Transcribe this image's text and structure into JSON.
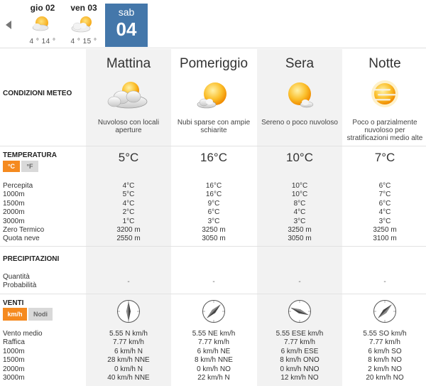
{
  "nav": {
    "prev_icon": "chevron-left-icon",
    "days": [
      {
        "name": "gio 02",
        "temp": "4 ° 14 °",
        "icon": "partly-cloudy-icon"
      },
      {
        "name": "ven 03",
        "temp": "4 ° 15 °",
        "icon": "partly-cloudy-icon"
      }
    ],
    "active_day": {
      "name": "sab",
      "number": "04",
      "color": "#4477aa"
    }
  },
  "periods": [
    {
      "label": "Mattina",
      "icon": "cloudy-sun-icon",
      "description": "Nuvoloso con locali aperture"
    },
    {
      "label": "Pomeriggio",
      "icon": "sun-small-cloud-icon",
      "description": "Nubi sparse con ampie schiarite"
    },
    {
      "label": "Sera",
      "icon": "sun-small-cloud-icon",
      "description": "Sereno o poco nuvoloso"
    },
    {
      "label": "Notte",
      "icon": "hazy-sun-icon",
      "description": "Poco o parzialmente nuvoloso per stratificazioni medio alte"
    }
  ],
  "sections": {
    "conditions": "CONDIZIONI METEO",
    "temperature": "TEMPERATURA",
    "precipitation": "PRECIPITAZIONI",
    "wind": "VENTI"
  },
  "units": {
    "temp_on": "°C",
    "temp_off": "°F",
    "wind_on": "km/h",
    "wind_off": "Nodi",
    "accent": "#f58a1f"
  },
  "temperature": {
    "main": [
      "5°C",
      "16°C",
      "10°C",
      "7°C"
    ],
    "row_labels": [
      "Percepita",
      "1000m",
      "1500m",
      "2000m",
      "3000m",
      "Zero Termico",
      "Quota neve"
    ],
    "columns": [
      [
        "4°C",
        "5°C",
        "4°C",
        "2°C",
        "1°C",
        "3200 m",
        "2550 m"
      ],
      [
        "16°C",
        "16°C",
        "9°C",
        "6°C",
        "3°C",
        "3250 m",
        "3050 m"
      ],
      [
        "10°C",
        "10°C",
        "8°C",
        "4°C",
        "3°C",
        "3250 m",
        "3050 m"
      ],
      [
        "6°C",
        "7°C",
        "6°C",
        "4°C",
        "3°C",
        "3250 m",
        "3100 m"
      ]
    ]
  },
  "precipitation": {
    "row_labels": [
      "Quantità",
      "Probabilità"
    ],
    "values": [
      "-",
      "-",
      "-",
      "-"
    ]
  },
  "wind": {
    "compass_directions": [
      "N",
      "NE",
      "ESE",
      "SO"
    ],
    "row_labels": [
      "Vento medio",
      "Raffica",
      "1000m",
      "1500m",
      "2000m",
      "3000m"
    ],
    "columns": [
      [
        "5.55 N km/h",
        "7.77 km/h",
        "6 km/h N",
        "28 km/h NNE",
        "0 km/h N",
        "40 km/h NNE"
      ],
      [
        "5.55 NE km/h",
        "7.77 km/h",
        "6 km/h NE",
        "8 km/h NNE",
        "0 km/h NO",
        "22 km/h N"
      ],
      [
        "5.55 ESE km/h",
        "7.77 km/h",
        "6 km/h ESE",
        "8 km/h ONO",
        "0 km/h NNO",
        "12 km/h NO"
      ],
      [
        "5.55 SO km/h",
        "7.77 km/h",
        "6 km/h SO",
        "8 km/h NO",
        "2 km/h NO",
        "20 km/h NO"
      ]
    ]
  }
}
